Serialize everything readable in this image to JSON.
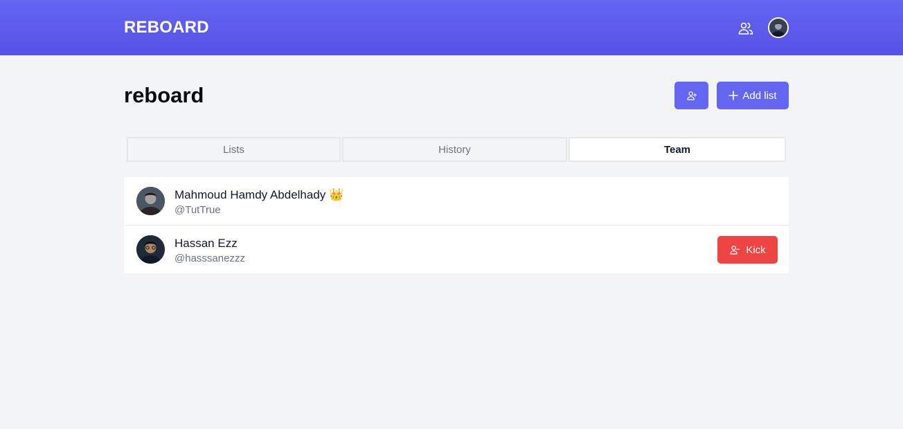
{
  "header": {
    "brand": "REBOARD",
    "team_icon": "users-icon",
    "avatar_icon": "user-avatar"
  },
  "board": {
    "title": "reboard",
    "invite_icon": "user-plus-icon",
    "add_list_label": "Add list"
  },
  "tabs": [
    {
      "label": "Lists",
      "active": false
    },
    {
      "label": "History",
      "active": false
    },
    {
      "label": "Team",
      "active": true
    }
  ],
  "members": [
    {
      "name": "Mahmoud Hamdy Abdelhady 👑",
      "handle": "@TutTrue",
      "owner": true
    },
    {
      "name": "Hassan Ezz",
      "handle": "@hasssanezzz",
      "owner": false,
      "kick_label": "Kick"
    }
  ],
  "colors": {
    "accent": "#6366f1",
    "danger": "#ef4444",
    "background": "#f3f4f6"
  }
}
